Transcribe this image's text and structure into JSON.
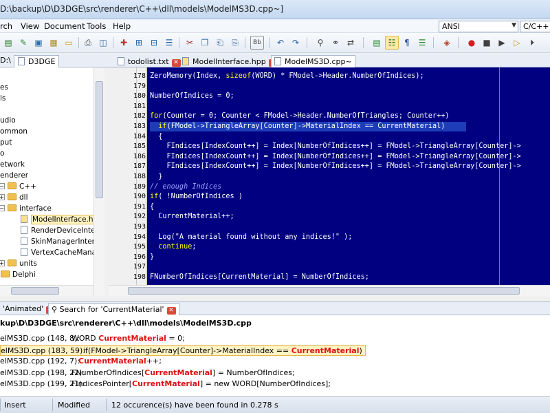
{
  "window": {
    "title": "D:\\backup\\D\\D3DGE\\src\\renderer\\C++\\dll\\models\\ModelMS3D.cpp~]"
  },
  "menu": {
    "items": [
      "rch",
      "View",
      "Document",
      "Tools",
      "Help"
    ]
  },
  "toolbar": {
    "encoding": "ANSI",
    "language": "C/C++ (c"
  },
  "left_panel": {
    "tab_partial": "D:\\",
    "tab_label": "D3DGE",
    "tree": [
      {
        "label": "es",
        "indent": 0,
        "kind": "text"
      },
      {
        "label": "ls",
        "indent": 0,
        "kind": "text"
      },
      {
        "label": "",
        "indent": 0,
        "kind": "text"
      },
      {
        "label": "udio",
        "indent": 0,
        "kind": "text"
      },
      {
        "label": "ommon",
        "indent": 0,
        "kind": "text"
      },
      {
        "label": "put",
        "indent": 0,
        "kind": "text"
      },
      {
        "label": "o",
        "indent": 0,
        "kind": "text"
      },
      {
        "label": "etwork",
        "indent": 0,
        "kind": "text"
      },
      {
        "label": "enderer",
        "indent": 0,
        "kind": "text"
      },
      {
        "label": "C++",
        "indent": 1,
        "kind": "folder",
        "exp": "-"
      },
      {
        "label": "dll",
        "indent": 2,
        "kind": "folder",
        "exp": "+"
      },
      {
        "label": "interface",
        "indent": 2,
        "kind": "folder",
        "exp": "-"
      },
      {
        "label": "ModelInterface.hpp",
        "indent": 3,
        "kind": "file",
        "selected": true
      },
      {
        "label": "RenderDeviceInterf",
        "indent": 3,
        "kind": "file"
      },
      {
        "label": "SkinManagerInterfa",
        "indent": 3,
        "kind": "file"
      },
      {
        "label": "VertexCacheManag",
        "indent": 3,
        "kind": "file"
      },
      {
        "label": "units",
        "indent": 2,
        "kind": "folder",
        "exp": "+"
      },
      {
        "label": "Delphi",
        "indent": 1,
        "kind": "folder",
        "exp": "+"
      }
    ]
  },
  "editor_tabs": [
    {
      "label": "todolist.txt",
      "active": false
    },
    {
      "label": "ModelInterface.hpp",
      "active": false
    },
    {
      "label": "ModelMS3D.cpp~",
      "active": true
    }
  ],
  "editor": {
    "current_line": "183",
    "lines": [
      {
        "n": "178",
        "html": "ZeroMemory(Index, <k>sizeof</k>(WORD) * FModel->Header.NumberOfIndices);"
      },
      {
        "n": "179",
        "html": ""
      },
      {
        "n": "180",
        "html": "NumberOfIndices = 0;"
      },
      {
        "n": "181",
        "html": ""
      },
      {
        "n": "182",
        "html": "<k>for</k>(Counter = 0; Counter < FModel->Header.NumberOfTriangles; Counter++)"
      },
      {
        "n": "183",
        "html": "  <k>if</k>(FModel->TriangleArray[Counter]->MaterialIndex == CurrentMaterial)"
      },
      {
        "n": "184",
        "html": "  {"
      },
      {
        "n": "185",
        "html": "    FIndices[IndexCount++] = Index[NumberOfIndices++] = FModel->TriangleArray[Counter]->"
      },
      {
        "n": "186",
        "html": "    FIndices[IndexCount++] = Index[NumberOfIndices++] = FModel->TriangleArray[Counter]->"
      },
      {
        "n": "187",
        "html": "    FIndices[IndexCount++] = Index[NumberOfIndices++] = FModel->TriangleArray[Counter]->"
      },
      {
        "n": "188",
        "html": "  }"
      },
      {
        "n": "189",
        "html": "<c>// enough Indices</c>"
      },
      {
        "n": "190",
        "html": "<k>if</k>( !NumberOfIndices )"
      },
      {
        "n": "191",
        "html": "{"
      },
      {
        "n": "192",
        "html": "  CurrentMaterial++;"
      },
      {
        "n": "193",
        "html": ""
      },
      {
        "n": "194",
        "html": "  Log(\"A material found without any indices!\" );"
      },
      {
        "n": "195",
        "html": "  <k>continue</k>;"
      },
      {
        "n": "196",
        "html": "}"
      },
      {
        "n": "197",
        "html": ""
      },
      {
        "n": "198",
        "html": "FNumberOfIndices[CurrentMaterial] = NumberOfIndices;"
      }
    ]
  },
  "bottom_tabs": [
    {
      "label": "'Animated'",
      "active": false
    },
    {
      "label": "Search for 'CurrentMaterial'",
      "active": true
    }
  ],
  "results": {
    "header": "kup\\D\\D3DGE\\src\\renderer\\C++\\dll\\models\\ModelMS3D.cpp",
    "rows": [
      {
        "ref": "elMS3D.cpp (148, 8):",
        "pre": "WORD ",
        "match": "CurrentMaterial",
        "post": " = 0;",
        "pad": 0
      },
      {
        "ref": "elMS3D.cpp (183, 59):",
        "pre": "if(FModel->TriangleArray[Counter]->MaterialIndex == ",
        "match": "CurrentMaterial",
        "post": ")",
        "pad": 16,
        "highlight": true
      },
      {
        "ref": "elMS3D.cpp (192, 7):",
        "pre": "",
        "match": "CurrentMaterial",
        "post": "++;",
        "pad": 10
      },
      {
        "ref": "elMS3D.cpp (198, 22):",
        "pre": "FNumberOfIndices[",
        "match": "CurrentMaterial",
        "post": "] = NumberOfIndices;",
        "pad": 0
      },
      {
        "ref": "elMS3D.cpp (199, 21):",
        "pre": "FIndicesPointer[",
        "match": "CurrentMaterial",
        "post": "] = new WORD[NumberOfIndices];",
        "pad": 0
      }
    ]
  },
  "status": {
    "position": "",
    "mode": "Insert",
    "modified": "Modified",
    "message": "12 occurence(s) have been found in 0.278 s"
  }
}
